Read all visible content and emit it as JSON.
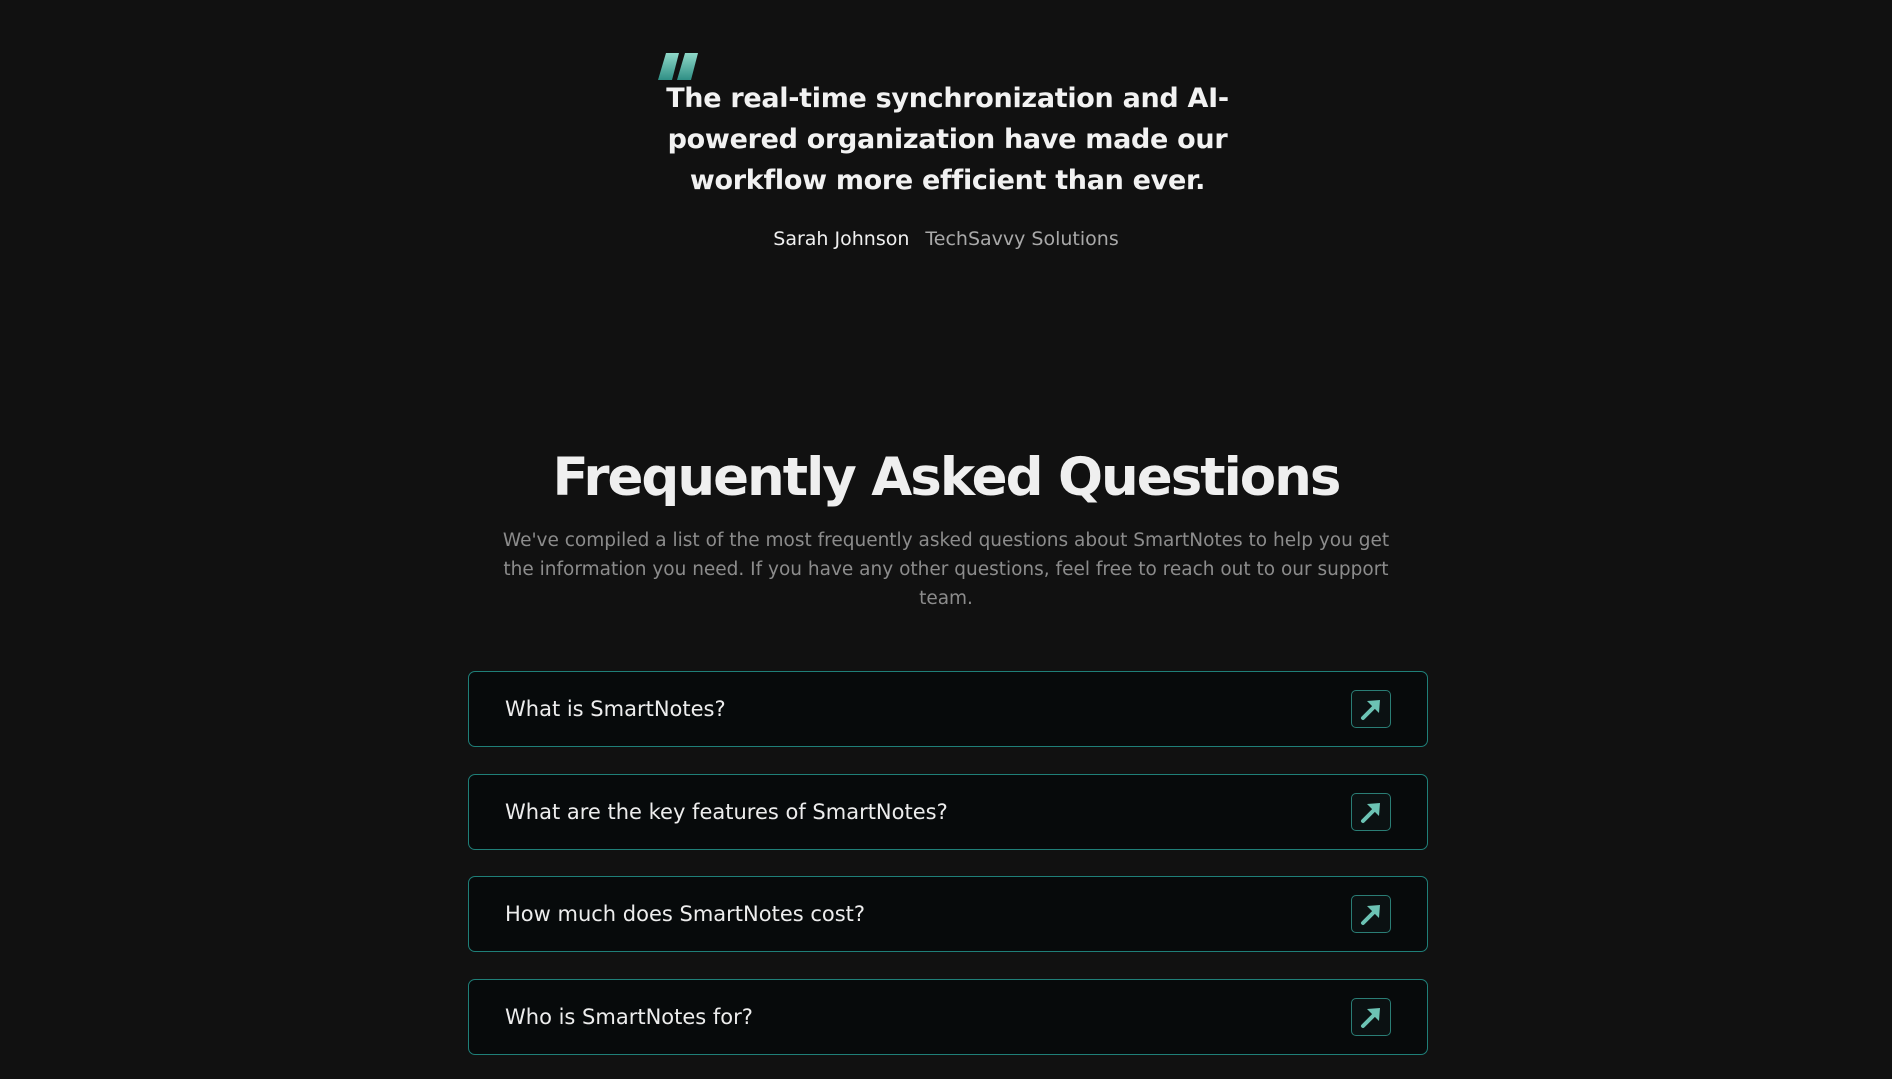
{
  "testimonial": {
    "quote_icon": "quote-mark-icon",
    "quote": "The real-time synchronization and AI-powered organization have made our workflow more efficient than ever.",
    "author": "Sarah Johnson",
    "company": "TechSavvy Solutions"
  },
  "faq": {
    "title": "Frequently Asked Questions",
    "subtitle": "We've compiled a list of the most frequently asked questions about SmartNotes to help you get the information you need. If you have any other questions, feel free to reach out to our support team.",
    "arrow_icon": "arrow-up-right-icon",
    "items": [
      {
        "question": "What is SmartNotes?"
      },
      {
        "question": "What are the key features of SmartNotes?"
      },
      {
        "question": "How much does SmartNotes cost?"
      },
      {
        "question": "Who is SmartNotes for?"
      }
    ]
  },
  "colors": {
    "background": "#111111",
    "accent": "#1f7f78",
    "accent_light": "#6cc3b4"
  }
}
